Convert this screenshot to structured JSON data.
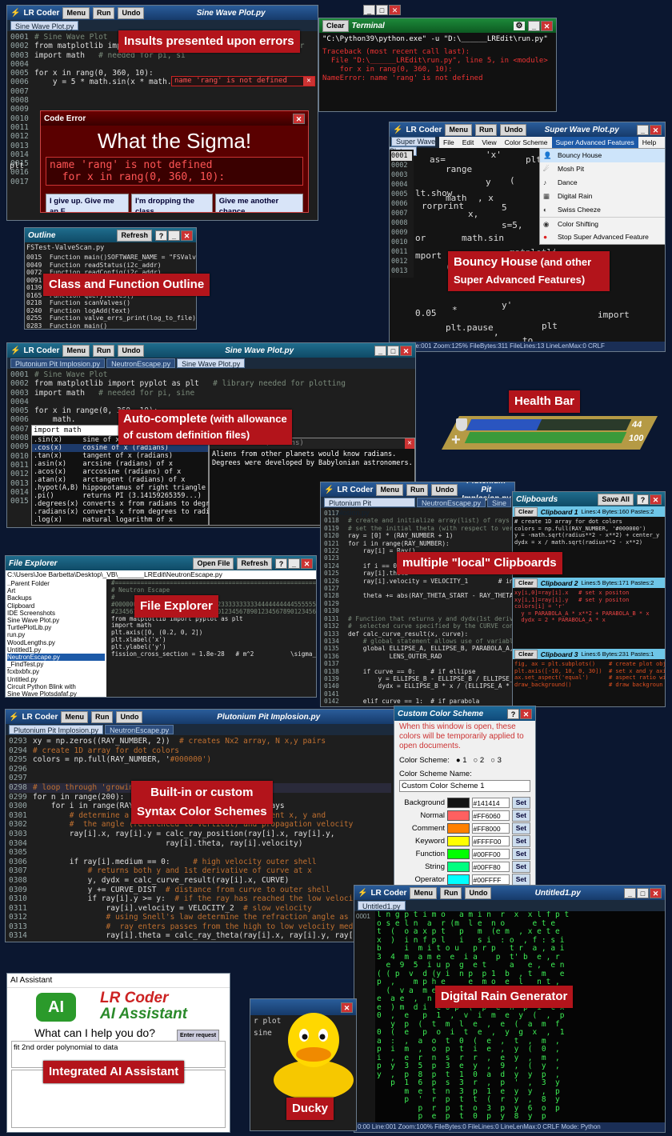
{
  "w1": {
    "title": "LR Coder",
    "menu": "Menu",
    "run": "Run",
    "undo": "Undo",
    "file_title": "Sine Wave Plot.py",
    "tab": "Sine Wave Plot.py",
    "lines": [
      [
        "0001",
        "# Sine Wave Plot",
        ""
      ],
      [
        "0002",
        "from matplotlib import pyplot as plt",
        "# library needed for"
      ],
      [
        "0003",
        "import math",
        "# needed for pi, si"
      ],
      [
        "0004",
        "",
        ""
      ],
      [
        "0005",
        "for x in rang(0, 360, 10):",
        ""
      ],
      [
        "0006",
        "    y = 5 * math.sin(x * math.pi/180)",
        ""
      ],
      [
        "0007",
        "",
        ""
      ],
      [
        "0008",
        "",
        ""
      ],
      [
        "0009",
        "",
        ""
      ],
      [
        "0010",
        "",
        ""
      ],
      [
        "0011",
        "",
        ""
      ],
      [
        "0012",
        "",
        ""
      ],
      [
        "0013",
        "",
        ""
      ],
      [
        "0014",
        "",
        ""
      ],
      [
        "0015",
        "",
        ""
      ],
      [
        "0016",
        "",
        ""
      ],
      [
        "0017",
        "",
        ""
      ]
    ],
    "err_pill": "name 'rang' is not defined",
    "plt_frag": "plt",
    "plt_frag2": "plt",
    "code_error": {
      "title": "Code Error",
      "heading": "What the Sigma!",
      "msg1": "name 'rang' is not defined",
      "msg2": "  for x in rang(0, 360, 10):",
      "b1": "I give up. Give me an F",
      "b2": "I'm dropping the class",
      "b3": "Give me another chance"
    }
  },
  "terminal": {
    "clear": "Clear",
    "title": "Terminal",
    "cmd": "\"C:\\Python39\\python.exe\" -u \"D:\\______LREdit\\run.py\"",
    "err": [
      "Traceback (most recent call last):",
      "  File \"D:\\______LREdit\\run.py\", line 5, in <module>",
      "    for x in rang(0, 360, 10):",
      "NameError: name 'rang' is not defined"
    ]
  },
  "outline": {
    "title": "Outline",
    "refresh": "Refresh",
    "file": "FSTest-ValveScan.py",
    "rows": [
      "0015  Function main()SOFTWARE_NAME = \"FSValveT",
      "0049  Function readStatus(i2c_addr)",
      "0072  Function readConfig(i2c_addr)",
      "0091  Function readPinAlg(i2c_addr)",
      "0139  Function queryValves()",
      "0165  Function queryValves()",
      "0218  Function scanValves()",
      "0240  Function logAdd(text)",
      "0255  Function valve_errs_print(log_to_file)",
      "0283  Function main()"
    ]
  },
  "w2": {
    "title": "LR Coder",
    "menu": "Menu",
    "run": "Run",
    "undo": "Undo",
    "file_title": "Super Wave Plot.py",
    "tab": "Super Wave Plot.py",
    "menubar": [
      "File",
      "Edit",
      "View",
      "Color Scheme",
      "Super Advanced Features",
      "Help"
    ],
    "menu_items": [
      "Bouncy House",
      "Mosh Pit",
      "Dance",
      "Digital Rain",
      "Swiss Cheeze",
      "Color Shifting",
      "Stop Super Advanced Feature"
    ],
    "gutter": [
      "0001",
      "0002",
      "0003",
      "0004",
      "0005",
      "0006",
      "0007",
      "0008",
      "0009",
      "0010",
      "0011",
      "0012",
      "0013"
    ],
    "scatter": [
      "as=",
      "'x'",
      "plt.scat",
      "range",
      "y",
      "(",
      "lt.show",
      "math",
      ", x",
      "rorprint",
      "x,",
      "5",
      "s=5,",
      "or",
      "math.sin",
      "mport",
      "matplotli",
      "(",
      "0.05",
      "*",
      "import",
      "plt.pause",
      "plt",
      "y'",
      ",",
      "to"
    ],
    "status": "0:00  Line:001  Zoom:125%  FileBytes:311  FileLines:13  LineLenMax:0        CRLF"
  },
  "w3": {
    "title": "LR Coder",
    "menu": "Menu",
    "run": "Run",
    "undo": "Undo",
    "file_title": "Sine Wave Plot.py",
    "tabs": [
      "Plutonium Pit Implosion.py",
      "NeutronEscape.py",
      "Sine Wave Plot.py"
    ],
    "lines": [
      [
        "0001",
        "# Sine Wave Plot",
        ""
      ],
      [
        "0002",
        "from matplotlib import pyplot as plt",
        "# library needed for plotting"
      ],
      [
        "0003",
        "import math",
        "# needed for pi, sine"
      ],
      [
        "0004",
        "",
        ""
      ],
      [
        "0005",
        "for x in range(0, 360, 10):",
        ""
      ],
      [
        "0006",
        "    math.",
        ""
      ],
      [
        "0007",
        "",
        ""
      ],
      [
        "0008",
        "",
        ""
      ],
      [
        "0009",
        "",
        ""
      ],
      [
        "0010",
        "",
        ""
      ],
      [
        "0011",
        "",
        ""
      ],
      [
        "0012",
        "",
        ""
      ],
      [
        "0013",
        "",
        ""
      ],
      [
        "0014",
        "",
        ""
      ],
      [
        "0015",
        "",
        ""
      ]
    ],
    "ac_input": "import math",
    "ac": [
      [
        ".sin(x)",
        "sine of x (radians)"
      ],
      [
        ".cos(x)",
        "cosine of x (radians)"
      ],
      [
        ".tan(x)",
        "tangent of x (radians)"
      ],
      [
        ".asin(x)",
        "arcsine (radians) of x"
      ],
      [
        ".acos(x)",
        "arccosine (radians) of x"
      ],
      [
        ".atan(x)",
        "arctangent (radians) of x"
      ],
      [
        ".hypot(A,B)",
        "hippopotamus of right triangle"
      ],
      [
        ".pi()",
        "returns PI (3.14159265359...)"
      ],
      [
        ".degrees(x)",
        "converts x from radians to degrees"
      ],
      [
        ".radians(x)",
        "converts x from degrees to radians"
      ],
      [
        ".log(x)",
        "natural logarithm of x"
      ]
    ],
    "ac_desc_title": "cosine of x (radians)",
    "ac_desc": "Aliens from other planets would know radians.\nDegrees were developed by Babylonian astronomers."
  },
  "health": {
    "title": "Health Bar",
    "shield": "44",
    "hp": "100",
    "shield_frac": 0.44,
    "hp_frac": 1.0
  },
  "files": {
    "title": "File Explorer",
    "open": "Open File",
    "refresh": "Refresh",
    "path": "C:\\Users\\Joe Barbetta\\Desktop\\_VB\\_______LREdit\\NeutronEscape.py",
    "items": [
      "..Parent Folder",
      "Art",
      "Backups",
      "Clipboard",
      "IDE Screenshots",
      "Sine Wave Plot.py",
      "TurtlePlotLib.py",
      "run.py",
      "WoodLengths.py",
      "Untitled1.py",
      "NeutronEscape.py",
      "_FindTest.py",
      "fcxbxbfx.py",
      "Untitled.py",
      "Circuit Python Blink with",
      "Sine Wave Plotsdafaf.py",
      "sdfsfdsf.py"
    ],
    "code": [
      "#=================================================================",
      "# Neutron Escape",
      "#",
      "#00000000011111111112222222222333333333344444444445555555555",
      "#23456789012345678901234567890123456789012345678901234567890",
      "",
      "",
      "from matplotlib import pyplot as plt",
      "import math",
      "",
      "plt.axis([0, (0.2, 0, 2])",
      "plt.xlabel('x')",
      "plt.ylabel('y')",
      "",
      "",
      "fission_cross_section = 1.8e-28   # m^2          \\sigma_fiss"
    ]
  },
  "w4": {
    "title": "LR Coder",
    "menu": "Menu",
    "run": "Run",
    "undo": "Undo",
    "file_title": "Plutonium Pit Implosion.py",
    "tabs": [
      "Plutonium Pit Implosion.py",
      "NeutronEscape.py",
      "Sine"
    ],
    "lines": [
      "",
      "# create and initialize array(list) of rays",
      "# set the initial theta (with respect to vertical",
      "ray = [0] * (RAY_NUMBER + 1)",
      "for i in range(RAY_NUMBER):",
      "    ray[i] = Ray()",
      "",
      "    if i == 0: the",
      "    ray[i].theta",
      "    ray[i].velocity = VELOCITY_1        # initia",
      "",
      "    theta += abs(RAY_THETA_START - RAY_THETA_END)",
      "",
      "",
      "# Function that returns y and dydx(1st derivative",
      "#  selected curve specified by the CURVE constant",
      "def calc_curve_result(x, curve):",
      "    # global statement allows use of variables de",
      "    global ELLIPSE_A, ELLIPSE_B, PARABOLA_A, PARA",
      "           LENS_OUTER_RAD",
      "",
      "    if curve == 0:    # if ellipse",
      "        y = ELLIPSE_B - ELLIPSE_B / ELLIPSE_A * ma",
      "        dydx = ELLIPSE_B * x / (ELLIPSE_A * math.s",
      "",
      "    elif curve == 1:  # if parabola"
    ],
    "gutter_start": 117
  },
  "clipboards": {
    "clear": "Clear",
    "title": "Clipboards",
    "saveall": "Save All",
    "c1": {
      "name": "Clipboard 1",
      "meta": "Lines:4  Bytes:160  Pastes:2",
      "text": [
        "# create 1D array for dot colors",
        "colors = np.full(RAY_NUMBER, '#000000')",
        "",
        "y = -math.sqrt(radius**2 - x**2) + center_y",
        "dydx = x / math.sqrt(radius**2 - x**2)"
      ]
    },
    "c2": {
      "name": "Clipboard 2",
      "meta": "Lines:5  Bytes:171  Pastes:2",
      "text": [
        "xy[i,0]=ray[i].x   # set x positon",
        "xy[i,1]=ray[i].y   # set y positon",
        "colors[i] = 'r'",
        "",
        "  y = PARABOLA_A * x**2 + PARABOLA_B * x",
        "  dydx = 2 * PARABOLA_A * x"
      ]
    },
    "c3": {
      "name": "Clipboard 3",
      "meta": "Lines:6  Bytes:231  Pastes:1",
      "text": [
        "fig, ax = plt.subplots()    # create plot obj",
        "plt.axis([-10, 10, 0, 30])  # set x and y axi",
        "",
        "ax.set_aspect('equal')      # aspect ratio wil",
        "",
        "draw_background()           # draw backgroun"
      ]
    }
  },
  "w5": {
    "title": "LR Coder",
    "menu": "Menu",
    "run": "Run",
    "undo": "Undo",
    "file_title": "Plutonium Pit Implosion.py",
    "tabs": [
      "Plutonium Pit Implosion.py",
      "NeutronEscape.py"
    ],
    "gutter_start": 293,
    "lines": [
      "xy = np.zeros((RAY_NUMBER, 2))  # creates Nx2 array, N x,y pairs",
      "# create 1D array for dot colors",
      "colors = np.full(RAY_NUMBER, '#000000')",
      "",
      "",
      "# loop through 'growing' of",
      "for n in range(200):",
      "    for i in range(RAY_NUMBER):                    rays",
      "        # determine a new x, y                  present x, y and",
      "        #  the angle (referenced to vertical) and propagation velocity",
      "        ray[i].x, ray[i].y = calc_ray_position(ray[i].x, ray[i].y,",
      "                             ray[i].theta, ray[i].velocity)",
      "",
      "        if ray[i].medium == 0:     # high velocity outer shell",
      "            # returns both y and 1st derivative of curve at x",
      "            y, dydx = calc_curve_result(ray[i].x, CURVE)",
      "            y += CURVE_DIST  # distance from curve to outer shell",
      "            if ray[i].y >= y:  # if the ray has reached the low velocity med",
      "                ray[i].velocity = VELOCITY_2  # slow velocity",
      "                # using Snell's law determine the refraction angle as the",
      "                #  ray enters passes from the high to low velocity medium",
      "                ray[i].theta = calc_ray_theta(ray[i].x, ray[i].y, ray[i].t"
    ]
  },
  "scheme": {
    "title": "Custom Color Scheme",
    "note": "When this window is open, these colors will be temporarily applied to open documents.",
    "label": "Color Scheme:",
    "opts": [
      "1",
      "2",
      "3"
    ],
    "name_label": "Color Scheme Name:",
    "name": "Custom Color Scheme 1",
    "rows": [
      [
        "Background",
        "#141414"
      ],
      [
        "Normal",
        "#FF6060"
      ],
      [
        "Comment",
        "#FF8000"
      ],
      [
        "Keyword",
        "#FFFF00"
      ],
      [
        "Function",
        "#00FF00"
      ],
      [
        "String",
        "#00FF80"
      ],
      [
        "Operator",
        "#00FFFF"
      ],
      [
        "Bracket",
        "#0000C0"
      ]
    ],
    "set": "Set"
  },
  "w6": {
    "title": "LR Coder",
    "menu": "Menu",
    "run": "Run",
    "undo": "Undo",
    "file_title": "Untitled1.py",
    "tab": "Untitled1.py",
    "status": "0:00  Line:001  Zoom:100%  FileBytes:0  FileLines:0  LineLenMax:0         CRLF          Mode: Python"
  },
  "ai": {
    "title": "AI Assistant",
    "brand1": "LR Coder",
    "brand2": "AI Assistant",
    "logo": "AI",
    "prompt": "What can I help you do?",
    "enter": "Enter request",
    "input": "fit 2nd order polynomial to data"
  },
  "ducky": {
    "frag1": "r plot",
    "frag2": "sine"
  },
  "labels": {
    "insults": "Insults presented upon errors",
    "outline": "Class and Function Outline",
    "bouncy1": "Bouncy House",
    "bouncy2": " (and other",
    "bouncy3": "Super Advanced Features)",
    "auto1": "Auto-complete",
    "auto2": " (with allowance",
    "auto3": "of custom definition files)",
    "health": "Health Bar",
    "clip": "multiple \"local\" Clipboards",
    "explorer": "File Explorer",
    "syntax1": "Built-in or custom",
    "syntax2": "Syntax Color Schemes",
    "rain": "Digital Rain Generator",
    "ai": "Integrated AI Assistant",
    "ducky": "Ducky"
  },
  "rain_lines": [
    "l n g p t i m o   a m i n  r  x  x l f p t",
    "o s e l n  a  r (m  l e  n o      e t e",
    "t  (  o a x p t   p   m  (e m  , x e t e",
    "x  )  i n f p l   i   s i  : o  , f : s i",
    "b     i  m i t o u   p r p   t r  a , a i",
    "3  4  m  a m e  e  i a    p  t' b  e , r",
    "  e  9  5  i u p  g  e t     a   e ,  e n",
    "( ( p  v  d (y i  n p  p 1  b  , t  m   e",
    "p  ,    m p h e     e  m o  e  l   n t ,",
    "  (  v a  m e  e  t n  s p e   n  ,  m e",
    "e  a e  ,  n  e  t p   m a  n  ,   i  e",
    "e  ) m  d i  c o p  (  p  e  n  p  i  c x",
    "0  ,  e   p  1  ,  v  i  m  e  y  (  ,  p",
    "   y  p  (  t  m  l  e  ,  e  (  a  m  f",
    "0  (  e   p  o  i  t  e  ,  y  g  x  ,  1",
    "a  :  ,  a  o  t  0  (  e  ,  t  ,  m  ,",
    "p  i  m  ,  o  p  t  i  e  ,  y  (  0  ,",
    "i  ,  e  r  n  s  r  r  ,  e  y  ,  m  ,",
    "p  y  3  5  p  3  e  y  ,  9  ,  (  y  ,",
    "y  ,  p  8  p  t  1  0  a  d  y  y  p  ,",
    "   p  1  6  p  s  3  r  ,  p  '  ,  3  y",
    "      m  e  t  n  3  p  1  e  y  y  ,  p",
    "      p  '  r  p  t  t  (  r  y  ,  8  y",
    "         p  r  p  t  o  3  p  y  6  o  p",
    "         p  e  p  t  0  p  y  8  y  p",
    "                 p  y  p  o  y  p",
    "                    p        p",
    "                    p     0  p  1"
  ]
}
